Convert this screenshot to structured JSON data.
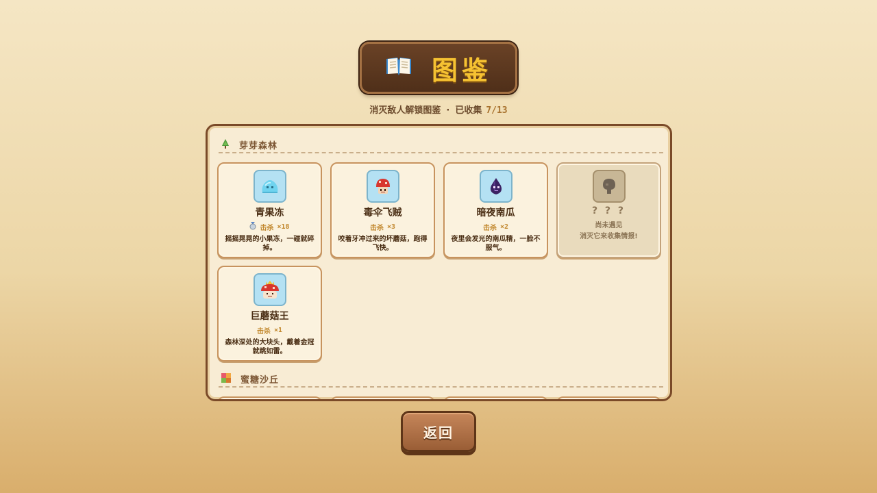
{
  "header": {
    "title": "图鉴",
    "title_icon": "open-book-icon",
    "subtitle_text": "消灭敌人解锁图鉴",
    "separator": "·",
    "collected_label": "已收集",
    "collected_count": "7/13"
  },
  "regions": [
    {
      "name": "芽芽森林",
      "icon": "pine-tree-icon",
      "enemies": [
        {
          "name": "青果冻",
          "kills_label": "击杀",
          "kills_count": "×18",
          "desc": "摇摇晃晃的小果冻，一碰就碎掉。",
          "icon": "cyan-slime-icon",
          "trophy_icon": "silver-medal-icon",
          "locked": false
        },
        {
          "name": "毒伞飞贼",
          "kills_label": "击杀",
          "kills_count": "×3",
          "desc": "咬着牙冲过来的坏蘑菇，跑得飞快。",
          "icon": "red-mushroom-icon",
          "locked": false
        },
        {
          "name": "暗夜南瓜",
          "kills_label": "击杀",
          "kills_count": "×2",
          "desc": "夜里会发光的南瓜精，一脸不服气。",
          "icon": "dark-pumpkin-icon",
          "locked": false
        },
        {
          "name": "? ? ?",
          "status": "尚未遇见",
          "desc": "消灭它来收集情报!",
          "icon": "unknown-silhouette-icon",
          "locked": true
        },
        {
          "name": "巨蘑菇王",
          "kills_label": "击杀",
          "kills_count": "×1",
          "desc": "森林深处的大块头，戴着金冠就跳如雷。",
          "icon": "mushroom-king-icon",
          "locked": false
        }
      ]
    },
    {
      "name": "蜜糖沙丘",
      "icon": "candy-dune-icon",
      "enemies": []
    }
  ],
  "footer": {
    "back_label": "返回"
  },
  "colors": {
    "accent_gold": "#f6c232",
    "plaque_brown": "#4f2f19",
    "card_bg": "#fbf2de",
    "portrait_bg": "#b4e1f3"
  }
}
